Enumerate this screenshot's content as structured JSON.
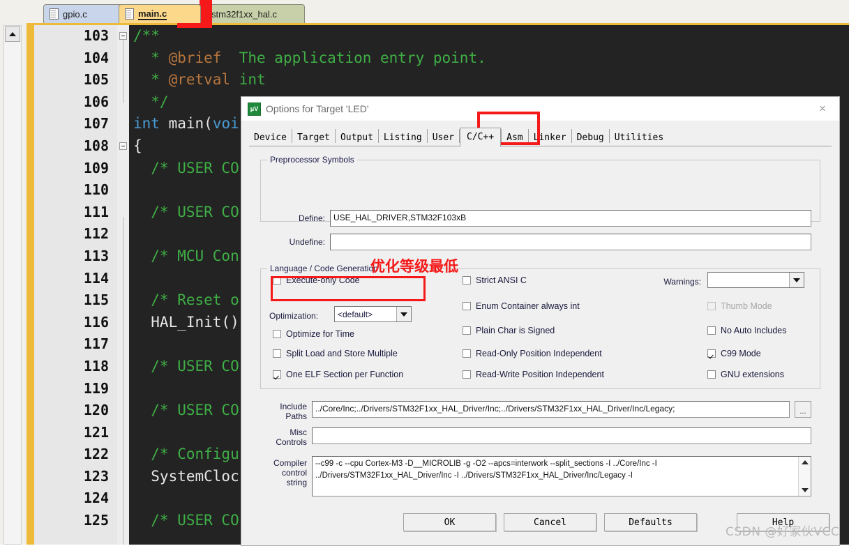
{
  "editor": {
    "tabs": [
      {
        "label": "gpio.c",
        "icon": "document-icon",
        "active": false
      },
      {
        "label": "main.c",
        "icon": "document-icon",
        "active": true
      },
      {
        "label": "stm32f1xx_hal.c",
        "icon": "document-icon",
        "active": false
      }
    ],
    "close_button_label": "x",
    "scroll_up_icon": "triangle-up-icon",
    "line_numbers": [
      103,
      104,
      105,
      106,
      107,
      108,
      109,
      110,
      111,
      112,
      113,
      114,
      115,
      116,
      117,
      118,
      119,
      120,
      121,
      122,
      123,
      124,
      125
    ],
    "code_lines": [
      {
        "n": 103,
        "fold": true,
        "segments": [
          {
            "t": "/**",
            "c": "c-doc"
          }
        ]
      },
      {
        "n": 104,
        "fold": false,
        "segments": [
          {
            "t": "  * ",
            "c": "c-doc"
          },
          {
            "t": "@brief",
            "c": "c-tag"
          },
          {
            "t": "  The application entry point.",
            "c": "c-doc"
          }
        ]
      },
      {
        "n": 105,
        "fold": false,
        "segments": [
          {
            "t": "  * ",
            "c": "c-doc"
          },
          {
            "t": "@retval",
            "c": "c-tag"
          },
          {
            "t": " int",
            "c": "c-doc"
          }
        ]
      },
      {
        "n": 106,
        "fold": false,
        "segments": [
          {
            "t": "  */",
            "c": "c-doc"
          }
        ]
      },
      {
        "n": 107,
        "fold": false,
        "segments": [
          {
            "t": "int",
            "c": "c-kw"
          },
          {
            "t": " ",
            "c": "c-pl"
          },
          {
            "t": "main",
            "c": "c-fn"
          },
          {
            "t": "(",
            "c": "c-pl"
          },
          {
            "t": "voi",
            "c": "c-kw"
          }
        ]
      },
      {
        "n": 108,
        "fold": true,
        "segments": [
          {
            "t": "{",
            "c": "c-pl"
          }
        ]
      },
      {
        "n": 109,
        "fold": false,
        "segments": [
          {
            "t": "  /* USER CO",
            "c": "c-com"
          }
        ]
      },
      {
        "n": 110,
        "fold": false,
        "segments": [
          {
            "t": "",
            "c": "c-com"
          }
        ]
      },
      {
        "n": 111,
        "fold": false,
        "segments": [
          {
            "t": "  /* USER CO",
            "c": "c-com"
          }
        ]
      },
      {
        "n": 112,
        "fold": false,
        "segments": [
          {
            "t": "",
            "c": "c-com"
          }
        ]
      },
      {
        "n": 113,
        "fold": false,
        "segments": [
          {
            "t": "  /* MCU Con",
            "c": "c-com"
          }
        ]
      },
      {
        "n": 114,
        "fold": false,
        "segments": [
          {
            "t": "",
            "c": "c-com"
          }
        ]
      },
      {
        "n": 115,
        "fold": false,
        "segments": [
          {
            "t": "  /* Reset o",
            "c": "c-com"
          }
        ]
      },
      {
        "n": 116,
        "fold": false,
        "segments": [
          {
            "t": "  HAL_Init()",
            "c": "c-pl"
          }
        ]
      },
      {
        "n": 117,
        "fold": false,
        "segments": [
          {
            "t": "",
            "c": "c-com"
          }
        ]
      },
      {
        "n": 118,
        "fold": false,
        "segments": [
          {
            "t": "  /* USER CO",
            "c": "c-com"
          }
        ]
      },
      {
        "n": 119,
        "fold": false,
        "segments": [
          {
            "t": "",
            "c": "c-com"
          }
        ]
      },
      {
        "n": 120,
        "fold": false,
        "segments": [
          {
            "t": "  /* USER CO",
            "c": "c-com"
          }
        ]
      },
      {
        "n": 121,
        "fold": false,
        "segments": [
          {
            "t": "",
            "c": "c-com"
          }
        ]
      },
      {
        "n": 122,
        "fold": false,
        "segments": [
          {
            "t": "  /* Configu",
            "c": "c-com"
          }
        ]
      },
      {
        "n": 123,
        "fold": false,
        "segments": [
          {
            "t": "  SystemCloc",
            "c": "c-pl"
          }
        ]
      },
      {
        "n": 124,
        "fold": false,
        "segments": [
          {
            "t": "",
            "c": "c-com"
          }
        ]
      },
      {
        "n": 125,
        "fold": false,
        "segments": [
          {
            "t": "  /* USER CO",
            "c": "c-com"
          }
        ]
      }
    ]
  },
  "dialog": {
    "title": "Options for Target 'LED'",
    "icon": "keil-uvision-icon",
    "icon_glyph": "μV",
    "close_icon": "close-icon",
    "close_glyph": "×",
    "tabs": [
      {
        "label": "Device",
        "active": false
      },
      {
        "label": "Target",
        "active": false
      },
      {
        "label": "Output",
        "active": false
      },
      {
        "label": "Listing",
        "active": false
      },
      {
        "label": "User",
        "active": false
      },
      {
        "label": "C/C++",
        "active": true
      },
      {
        "label": "Asm",
        "active": false
      },
      {
        "label": "Linker",
        "active": false
      },
      {
        "label": "Debug",
        "active": false
      },
      {
        "label": "Utilities",
        "active": false
      }
    ],
    "preprocessor": {
      "group_label": "Preprocessor Symbols",
      "define_label": "Define:",
      "define_value": "USE_HAL_DRIVER,STM32F103xB",
      "undefine_label": "Undefine:",
      "undefine_value": ""
    },
    "language": {
      "group_label": "Language / Code Generation",
      "col1": [
        {
          "label": "Execute-only Code",
          "checked": false,
          "enabled": true
        },
        {
          "label": "Optimize for Time",
          "checked": false,
          "enabled": true
        },
        {
          "label": "Split Load and Store Multiple",
          "checked": false,
          "enabled": true
        },
        {
          "label": "One ELF Section per Function",
          "checked": true,
          "enabled": true
        }
      ],
      "optimization_label": "Optimization:",
      "optimization_value": "<default>",
      "col2": [
        {
          "label": "Strict ANSI C",
          "checked": false,
          "enabled": true
        },
        {
          "label": "Enum Container always int",
          "checked": false,
          "enabled": true
        },
        {
          "label": "Plain Char is Signed",
          "checked": false,
          "enabled": true
        },
        {
          "label": "Read-Only Position Independent",
          "checked": false,
          "enabled": true
        },
        {
          "label": "Read-Write Position Independent",
          "checked": false,
          "enabled": true
        }
      ],
      "warnings_label": "Warnings:",
      "warnings_value": "",
      "col3": [
        {
          "label": "Thumb Mode",
          "checked": false,
          "enabled": false
        },
        {
          "label": "No Auto Includes",
          "checked": false,
          "enabled": true
        },
        {
          "label": "C99 Mode",
          "checked": true,
          "enabled": true
        },
        {
          "label": "GNU extensions",
          "checked": false,
          "enabled": true
        }
      ]
    },
    "paths": {
      "include_label_line1": "Include",
      "include_label_line2": "Paths",
      "include_value": "../Core/Inc;../Drivers/STM32F1xx_HAL_Driver/Inc;../Drivers/STM32F1xx_HAL_Driver/Inc/Legacy;",
      "browse_label": "...",
      "misc_label_line1": "Misc",
      "misc_label_line2": "Controls",
      "misc_value": "",
      "compiler_label_line1": "Compiler",
      "compiler_label_line2": "control",
      "compiler_label_line3": "string",
      "compiler_value_line1": "--c99 -c --cpu Cortex-M3 -D__MICROLIB -g -O2 --apcs=interwork --split_sections -I ../Core/Inc -I",
      "compiler_value_line2": "../Drivers/STM32F1xx_HAL_Driver/Inc -I ../Drivers/STM32F1xx_HAL_Driver/Inc/Legacy -I",
      "scroll_up_icon": "triangle-up-icon",
      "scroll_down_icon": "triangle-down-icon"
    },
    "buttons": [
      {
        "label": "OK",
        "name": "ok-button"
      },
      {
        "label": "Cancel",
        "name": "cancel-button"
      },
      {
        "label": "Defaults",
        "name": "defaults-button"
      },
      {
        "label": "Help",
        "name": "help-button"
      }
    ]
  },
  "annotations": {
    "optimization_note": "优化等级最低",
    "accent_color": "#f51919"
  },
  "watermark": {
    "text": "CSDN @好家伙VCC"
  }
}
